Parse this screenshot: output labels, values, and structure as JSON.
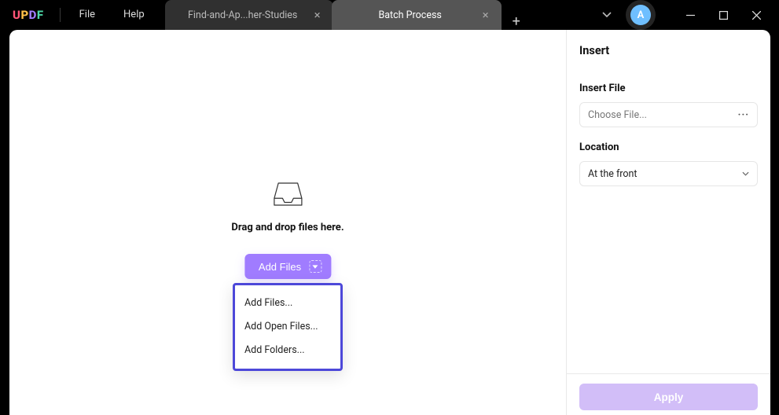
{
  "logo": {
    "u": "U",
    "p": "P",
    "d": "D",
    "f": "F"
  },
  "menu": {
    "file": "File",
    "help": "Help"
  },
  "tabs": {
    "inactive": {
      "label": "Find-and-Ap...her-Studies"
    },
    "active": {
      "label": "Batch Process"
    }
  },
  "avatar": {
    "initial": "A"
  },
  "dropzone": {
    "text": "Drag and drop files here.",
    "button": "Add Files"
  },
  "dropdown": {
    "items": [
      "Add Files...",
      "Add Open Files...",
      "Add Folders..."
    ]
  },
  "sidebar": {
    "title": "Insert",
    "insert_file_label": "Insert File",
    "choose_file_placeholder": "Choose File...",
    "location_label": "Location",
    "location_value": "At the front",
    "apply": "Apply"
  }
}
